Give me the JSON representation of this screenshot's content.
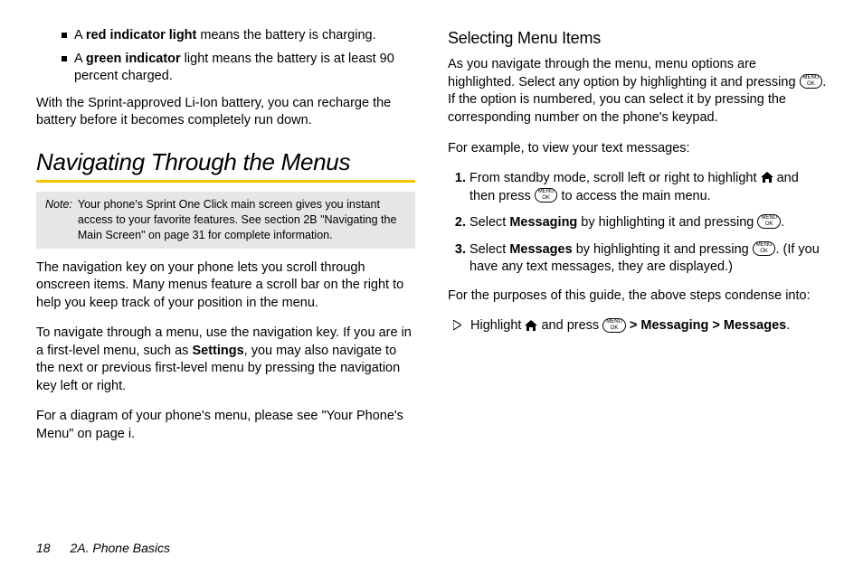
{
  "left": {
    "bullet_red_pre": "A ",
    "bullet_red_bold": "red indicator light",
    "bullet_red_post": " means the battery is charging.",
    "bullet_green_pre": "A ",
    "bullet_green_bold": "green indicator",
    "bullet_green_post": " light means the battery is at least 90 percent charged.",
    "sprint_para": "With the Sprint-approved Li-Ion battery, you can recharge the battery before it becomes completely run down.",
    "heading": "Navigating Through the Menus",
    "note_label": "Note:",
    "note_body": "Your phone's Sprint One Click main screen gives you instant access to your favorite features. See section 2B \"Navigating the Main Screen\" on page 31 for complete information.",
    "nav_para1": "The navigation key on your phone lets you scroll through onscreen items. Many menus feature a scroll bar on the right to help you keep track of your position in the menu.",
    "nav_para2_a": "To navigate through a menu, use the navigation key. If you are in a first-level menu, such as ",
    "nav_para2_bold": "Settings",
    "nav_para2_b": ", you may also navigate to the next or previous first-level menu by pressing the navigation key left or right.",
    "nav_para3": "For a diagram of your phone's menu, please see \"Your Phone's Menu\" on page i."
  },
  "right": {
    "subheading": "Selecting Menu Items",
    "intro_a": "As you navigate through the menu, menu options are highlighted. Select any option by highlighting it and pressing ",
    "intro_b": ". If the option is numbered, you can select it by pressing the corresponding number on the phone's keypad.",
    "example_lead": "For example, to view your text messages:",
    "step1_a": "From standby mode, scroll left or right to highlight ",
    "step1_b": " and then press ",
    "step1_c": " to access the main menu.",
    "step2_a": "Select ",
    "step2_bold": "Messaging",
    "step2_b": " by highlighting it and pressing ",
    "step2_c": ".",
    "step3_a": "Select ",
    "step3_bold": "Messages",
    "step3_b": " by highlighting it and pressing ",
    "step3_c": ". (If you have any text messages, they are displayed.)",
    "condense": "For the purposes of this guide, the above steps condense into:",
    "arrow_a": "Highlight ",
    "arrow_b": " and press ",
    "arrow_gt1": " > ",
    "arrow_bold1": "Messaging",
    "arrow_gt2": " > ",
    "arrow_bold2": "Messages",
    "arrow_end": "."
  },
  "footer": {
    "page": "18",
    "section": "2A. Phone Basics"
  },
  "ok": {
    "l1": "MENU",
    "l2": "OK"
  }
}
